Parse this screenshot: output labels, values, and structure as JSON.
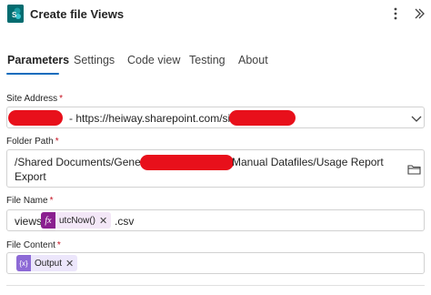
{
  "header": {
    "title": "Create file Views",
    "app_icon": "sharepoint-icon",
    "more_icon": "more-vertical-icon",
    "collapse_icon": "collapse-icon"
  },
  "tabs": [
    {
      "label": "Parameters",
      "active": true
    },
    {
      "label": "Settings",
      "active": false
    },
    {
      "label": "Code view",
      "active": false
    },
    {
      "label": "Testing",
      "active": false
    },
    {
      "label": "About",
      "active": false
    }
  ],
  "fields": {
    "site_address": {
      "label": "Site Address",
      "required": "*",
      "value_middle": "- https://heiway.sharepoint.com/sites/"
    },
    "folder_path": {
      "label": "Folder Path",
      "required": "*",
      "line1_start": "/Shared Documents/General",
      "line1_end": "Manual Datafiles/Usage Report",
      "line2": "Export"
    },
    "file_name": {
      "label": "File Name",
      "required": "*",
      "prefix": "views",
      "token_badge": "fx",
      "token_label": "utcNow()",
      "token_remove": "✕",
      "suffix": ".csv"
    },
    "file_content": {
      "label": "File Content",
      "required": "*",
      "token_badge": "{x}",
      "token_label": "Output",
      "token_remove": "✕"
    }
  },
  "colors": {
    "accent": "#0f6cbd",
    "redaction": "#e8101b",
    "fx_token": "#8a1f8f",
    "output_token": "#8d6ad6"
  }
}
